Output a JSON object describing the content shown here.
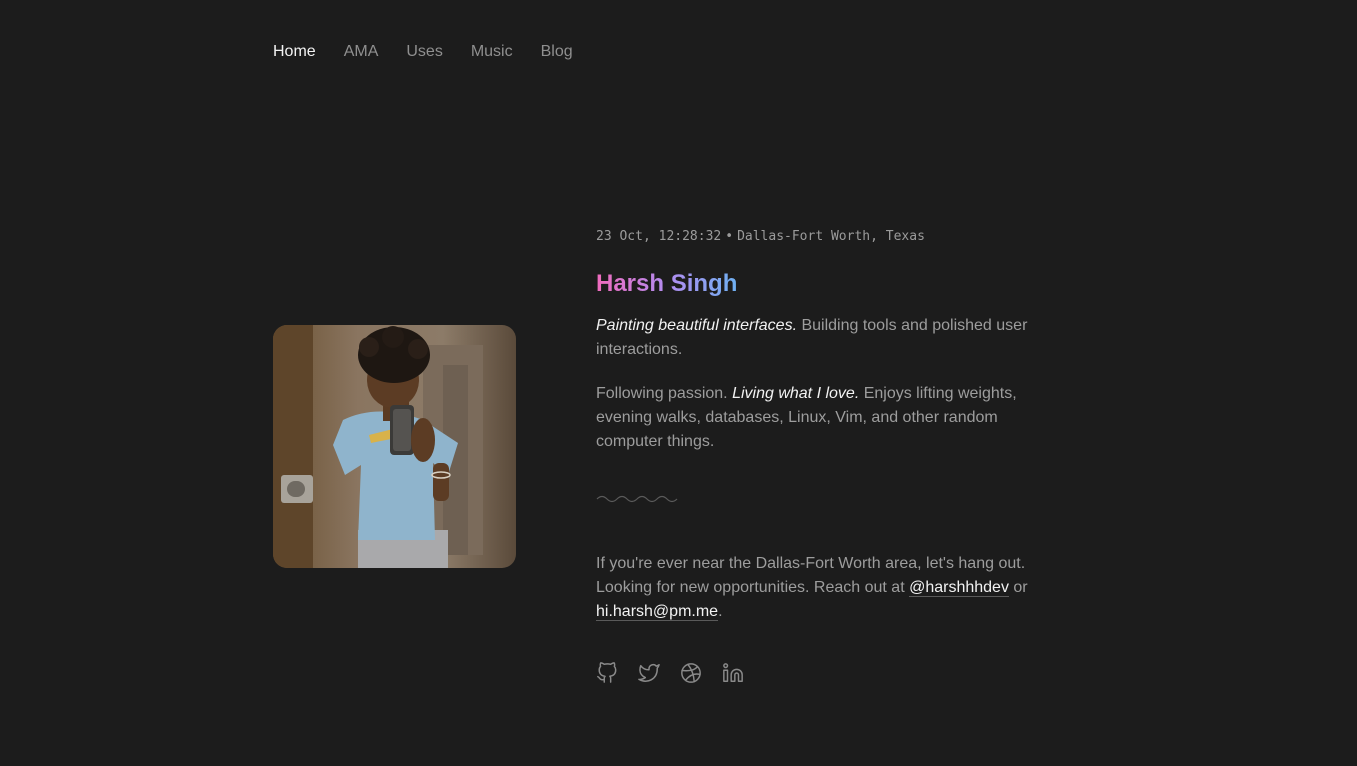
{
  "nav": {
    "items": [
      {
        "label": "Home",
        "active": true
      },
      {
        "label": "AMA",
        "active": false
      },
      {
        "label": "Uses",
        "active": false
      },
      {
        "label": "Music",
        "active": false
      },
      {
        "label": "Blog",
        "active": false
      }
    ]
  },
  "profile": {
    "datetime": "23 Oct, 12:28:32",
    "separator": "•",
    "location": "Dallas-Fort Worth, Texas",
    "name": "Harsh Singh",
    "photo_icon": "profile-photo"
  },
  "bio": {
    "p1_em": "Painting beautiful interfaces.",
    "p1_text": " Building tools and polished user interactions.",
    "p2_prefix": "Following passion. ",
    "p2_em": "Living what I love.",
    "p2_text": " Enjoys lifting weights, evening walks, databases, Linux, Vim, and other random computer things.",
    "p3_text": "If you're ever near the Dallas-Fort Worth area, let's hang out. Looking for new opportunities. Reach out at ",
    "p3_handle": "@harshhhdev",
    "p3_or": " or ",
    "p3_email": "hi.harsh@pm.me",
    "p3_end": "."
  },
  "socials": [
    {
      "icon": "github-icon"
    },
    {
      "icon": "twitter-icon"
    },
    {
      "icon": "dribbble-icon"
    },
    {
      "icon": "linkedin-icon"
    }
  ],
  "colors": {
    "background": "#1c1c1c",
    "text_muted": "#9d9d9d",
    "text_bright": "#f2f2f2",
    "name_gradient_start": "#f06bbd",
    "name_gradient_end": "#6fb0f2"
  }
}
